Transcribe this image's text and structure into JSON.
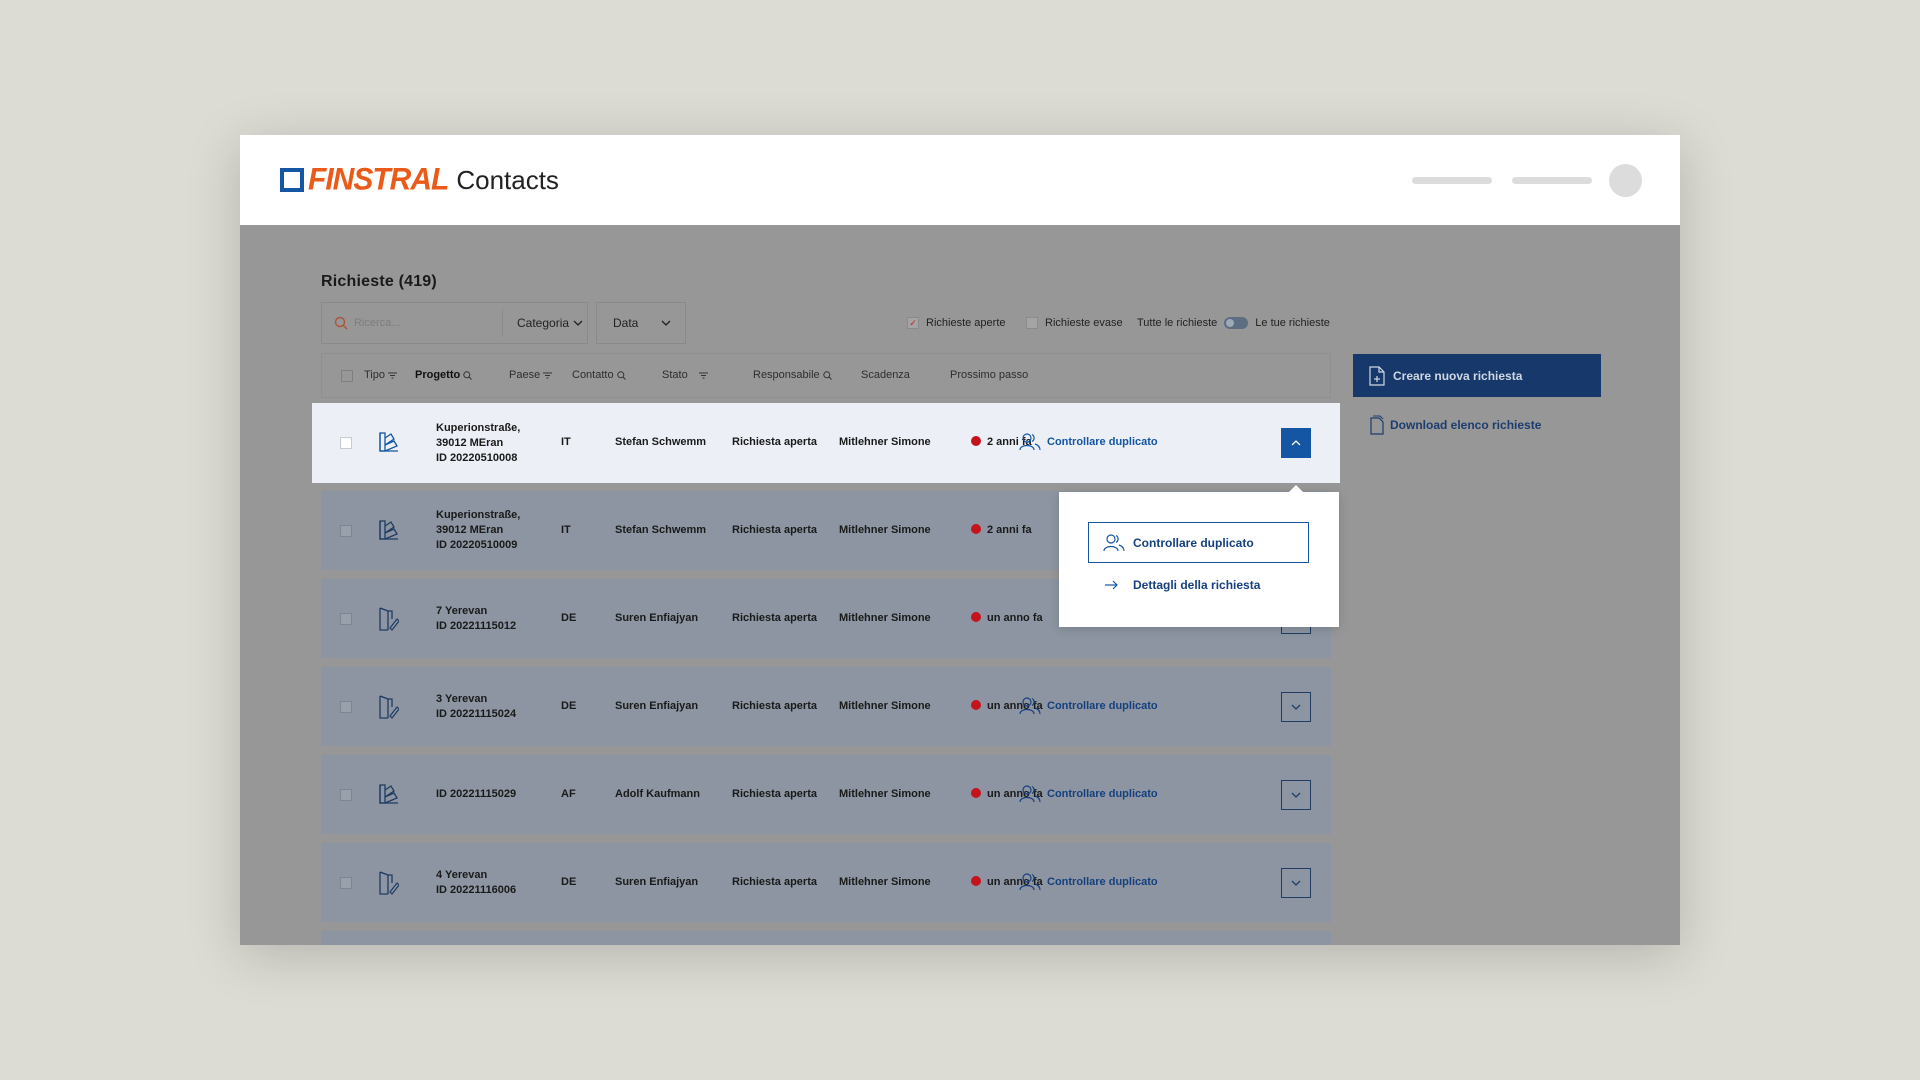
{
  "app": {
    "brand": "FINSTRAL",
    "app_name": "Contacts"
  },
  "list": {
    "title": "Richieste (419)"
  },
  "filters": {
    "search_placeholder": "Ricerca...",
    "category_label": "Categoria",
    "date_label": "Data",
    "open_requests_label": "Richieste aperte",
    "open_requests_checked": true,
    "closed_requests_label": "Richieste evase",
    "closed_requests_checked": false,
    "all_requests_label": "Tutte le richieste",
    "your_requests_label": "Le tue richieste"
  },
  "columns": {
    "type": "Tipo",
    "project": "Progetto",
    "country": "Paese",
    "contact": "Contatto",
    "status": "Stato",
    "owner": "Responsabile",
    "deadline": "Scadenza",
    "next_step": "Prossimo passo"
  },
  "rows": [
    {
      "project_lines": [
        "Kuperionstraße,",
        "39012 MEran",
        "ID 20220510008"
      ],
      "type_icon": "swatch-icon",
      "country": "IT",
      "contact": "Stefan Schwemm",
      "status": "Richiesta aperta",
      "owner": "Mitlehner Simone",
      "deadline": "2 anni fa",
      "next_step": "Controllare duplicato",
      "expanded": true
    },
    {
      "project_lines": [
        "Kuperionstraße,",
        "39012 MEran",
        "ID 20220510009"
      ],
      "type_icon": "swatch-icon",
      "country": "IT",
      "contact": "Stefan Schwemm",
      "status": "Richiesta aperta",
      "owner": "Mitlehner Simone",
      "deadline": "2 anni fa",
      "next_step": "",
      "expanded": false
    },
    {
      "project_lines": [
        "7 Yerevan",
        "ID 20221115012"
      ],
      "type_icon": "door-icon",
      "country": "DE",
      "contact": "Suren Enfiajyan",
      "status": "Richiesta aperta",
      "owner": "Mitlehner Simone",
      "deadline": "un anno fa",
      "next_step": "",
      "expanded": false
    },
    {
      "project_lines": [
        "3 Yerevan",
        "ID 20221115024"
      ],
      "type_icon": "door-icon",
      "country": "DE",
      "contact": "Suren Enfiajyan",
      "status": "Richiesta aperta",
      "owner": "Mitlehner Simone",
      "deadline": "un anno fa",
      "next_step": "Controllare duplicato",
      "expanded": false
    },
    {
      "project_lines": [
        "ID 20221115029"
      ],
      "type_icon": "swatch-icon",
      "country": "AF",
      "contact": "Adolf Kaufmann",
      "status": "Richiesta aperta",
      "owner": "Mitlehner Simone",
      "deadline": "un anno fa",
      "next_step": "Controllare duplicato",
      "expanded": false
    },
    {
      "project_lines": [
        "4 Yerevan",
        "ID 20221116006"
      ],
      "type_icon": "door-icon",
      "country": "DE",
      "contact": "Suren Enfiajyan",
      "status": "Richiesta aperta",
      "owner": "Mitlehner Simone",
      "deadline": "un anno fa",
      "next_step": "Controllare duplicato",
      "expanded": false
    }
  ],
  "actions": {
    "create_label": "Creare nuova richiesta",
    "download_label": "Download elenco richieste"
  },
  "popup": {
    "primary_label": "Controllare duplicato",
    "secondary_label": "Dettagli della richiesta"
  },
  "colors": {
    "brand_orange": "#ea5a18",
    "brand_blue": "#1455a4",
    "dark_blue": "#17386a",
    "status_red": "#c4131b"
  }
}
